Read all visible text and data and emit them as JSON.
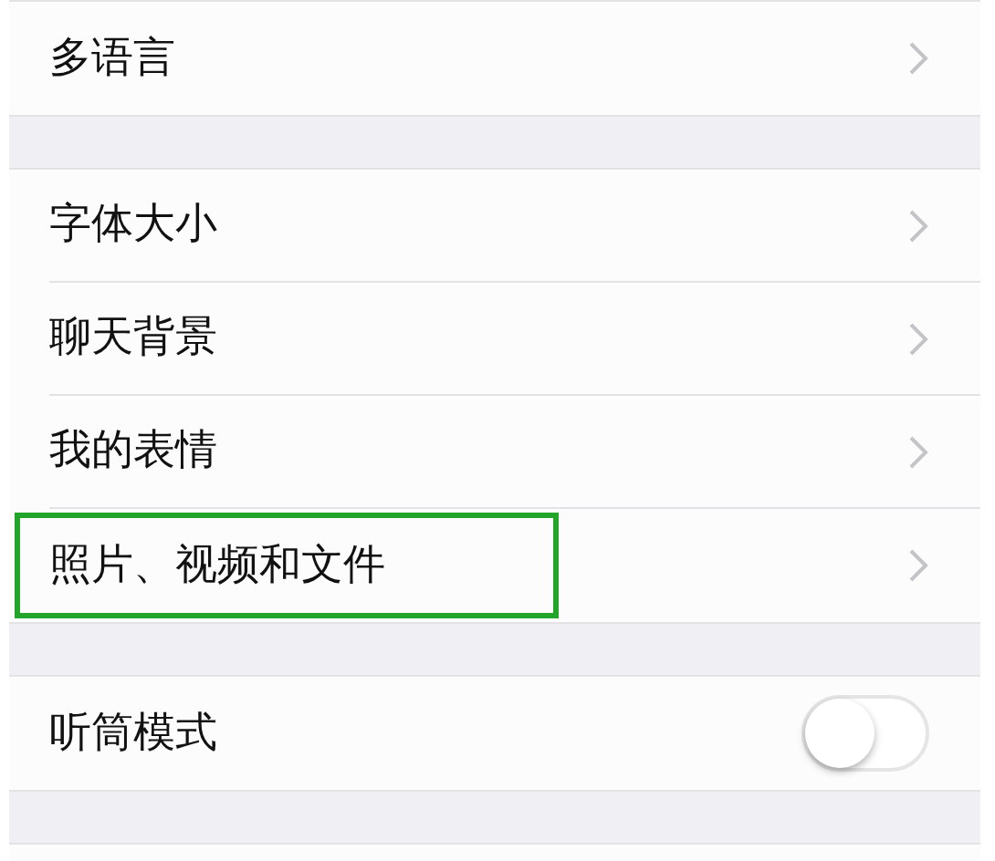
{
  "groups": [
    {
      "items": [
        {
          "kind": "link",
          "label": "多语言",
          "highlighted": false
        }
      ]
    },
    {
      "items": [
        {
          "kind": "link",
          "label": "字体大小",
          "highlighted": false
        },
        {
          "kind": "link",
          "label": "聊天背景",
          "highlighted": false
        },
        {
          "kind": "link",
          "label": "我的表情",
          "highlighted": false
        },
        {
          "kind": "link",
          "label": "照片、视频和文件",
          "highlighted": true
        }
      ]
    },
    {
      "items": [
        {
          "kind": "toggle",
          "label": "听筒模式",
          "on": false,
          "highlighted": false
        }
      ]
    }
  ]
}
